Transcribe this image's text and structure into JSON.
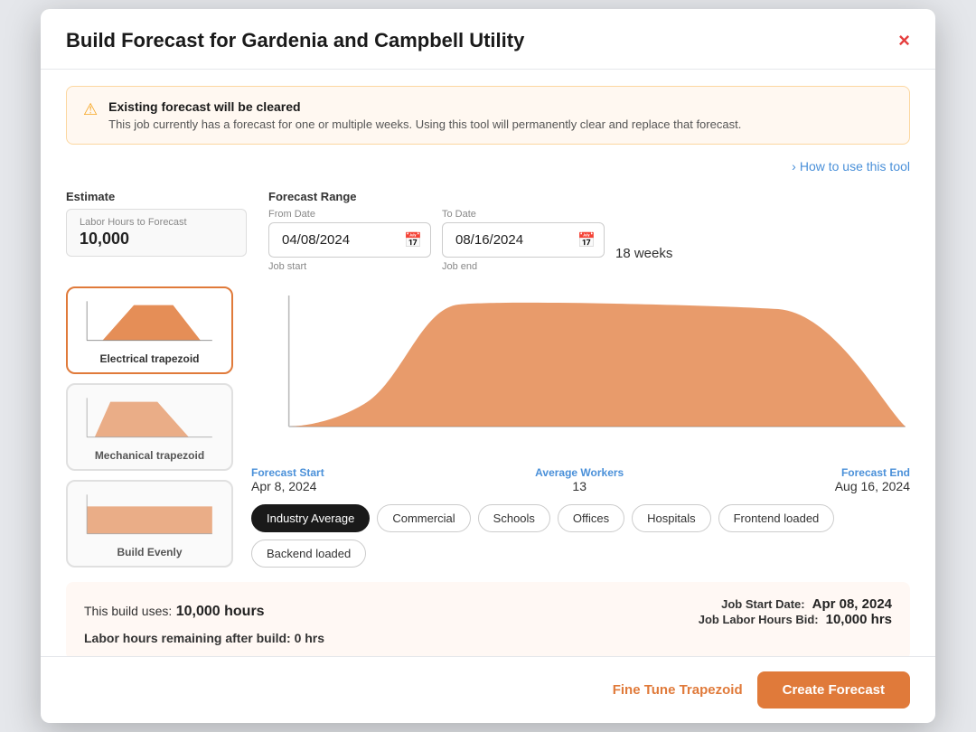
{
  "modal": {
    "title": "Build Forecast for Gardenia and Campbell Utility",
    "close_label": "×"
  },
  "warning": {
    "title": "Existing forecast will be cleared",
    "text": "This job currently has a forecast for one or multiple weeks. Using this tool will permanently clear and replace that forecast.",
    "icon": "⚠"
  },
  "how_to": {
    "label": "How to use this tool",
    "chevron": "›"
  },
  "estimate": {
    "label": "Estimate",
    "field_label": "Labor Hours to Forecast",
    "value": "10,000"
  },
  "forecast_range": {
    "label": "Forecast Range",
    "from_label": "From Date",
    "from_value": "04/08/2024",
    "from_note": "Job start",
    "to_label": "To Date",
    "to_value": "08/16/2024",
    "to_note": "Job end",
    "weeks": "18 weeks"
  },
  "curves": [
    {
      "id": "electrical-trapezoid",
      "label": "Electrical trapezoid",
      "active": true
    },
    {
      "id": "mechanical-trapezoid",
      "label": "Mechanical trapezoid",
      "active": false
    },
    {
      "id": "build-evenly",
      "label": "Build Evenly",
      "active": false
    }
  ],
  "chart": {
    "forecast_start_label": "Forecast Start",
    "forecast_start_value": "Apr 8, 2024",
    "avg_workers_label": "Average Workers",
    "avg_workers_value": "13",
    "forecast_end_label": "Forecast End",
    "forecast_end_value": "Aug 16, 2024"
  },
  "pills": [
    {
      "label": "Industry Average",
      "active": true
    },
    {
      "label": "Commercial",
      "active": false
    },
    {
      "label": "Schools",
      "active": false
    },
    {
      "label": "Offices",
      "active": false
    },
    {
      "label": "Hospitals",
      "active": false
    },
    {
      "label": "Frontend loaded",
      "active": false
    },
    {
      "label": "Backend loaded",
      "active": false
    }
  ],
  "stats": {
    "uses_prefix": "This build uses:",
    "hours_value": "10,000 hours",
    "remaining_prefix": "Labor hours remaining after build:",
    "remaining_value": "0 hrs",
    "job_start_label": "Job Start Date:",
    "job_start_value": "Apr 08, 2024",
    "job_bid_label": "Job Labor Hours Bid:",
    "job_bid_value": "10,000 hrs"
  },
  "footer": {
    "fine_tune_label": "Fine Tune Trapezoid",
    "create_label": "Create Forecast"
  }
}
